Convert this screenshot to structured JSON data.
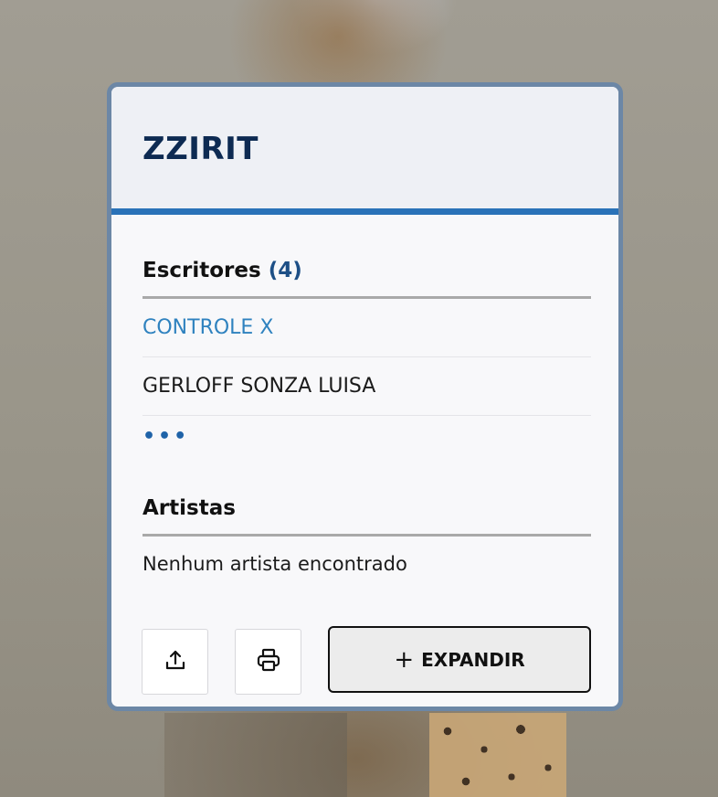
{
  "card": {
    "title": "ZZIRIT",
    "writers": {
      "heading": "Escritores",
      "count": "(4)",
      "items": [
        {
          "label": "CONTROLE X",
          "is_link": true
        },
        {
          "label": "GERLOFF SONZA LUISA",
          "is_link": false
        }
      ],
      "more_label": "•••"
    },
    "artists": {
      "heading": "Artistas",
      "empty_text": "Nenhum artista encontrado"
    },
    "actions": {
      "share_icon": "share-upload-icon",
      "print_icon": "printer-icon",
      "expand_plus": "+",
      "expand_label": "EXPANDIR"
    }
  },
  "colors": {
    "title": "#0d2a52",
    "accent_bar": "#2a72b8",
    "link": "#2f82bf",
    "count": "#1d4f86",
    "card_border": "#6c87a6"
  }
}
